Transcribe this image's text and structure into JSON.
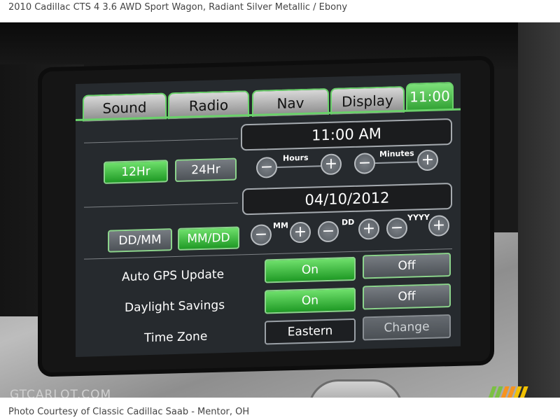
{
  "caption_top": "2010 Cadillac CTS 4 3.6 AWD Sport Wagon,  Radiant Silver Metallic / Ebony",
  "caption_bottom": "Photo Courtesy of Classic Cadillac Saab - Mentor, OH",
  "watermark": "GTCARLOT.COM",
  "tabs": [
    "Sound",
    "Radio",
    "Nav",
    "Display",
    "11:00"
  ],
  "active_tab": "11:00",
  "time": {
    "value": "11:00 AM",
    "hours_label": "Hours",
    "minutes_label": "Minutes",
    "format_12": "12Hr",
    "format_24": "24Hr",
    "selected_format": "12Hr"
  },
  "date": {
    "value": "04/10/2012",
    "mm_label": "MM",
    "dd_label": "DD",
    "yyyy_label": "YYYY",
    "order_ddmm": "DD/MM",
    "order_mmdd": "MM/DD",
    "selected_order": "MM/DD"
  },
  "plus": "+",
  "minus": "−",
  "settings": {
    "auto_gps_label": "Auto GPS Update",
    "auto_gps_on": "On",
    "auto_gps_off": "Off",
    "auto_gps_state": "On",
    "daylight_label": "Daylight Savings",
    "daylight_on": "On",
    "daylight_off": "Off",
    "daylight_state": "On",
    "timezone_label": "Time Zone",
    "timezone_value": "Eastern",
    "timezone_change": "Change"
  },
  "colors": {
    "active_green": "#2fa032",
    "screen_bg": "#262a2e",
    "trim_silver": "#b0b0b0"
  }
}
